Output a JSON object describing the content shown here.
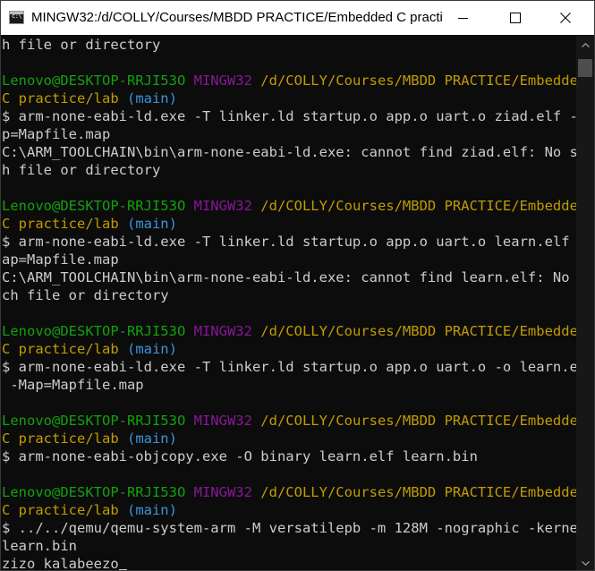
{
  "window": {
    "title": "MINGW32:/d/COLLY/Courses/MBDD PRACTICE/Embedded C practi…",
    "icon": "terminal-icon"
  },
  "colors": {
    "background": "#0c0c0c",
    "text": "#cccccc",
    "user_host": "#13a10e",
    "mingw": "#881798",
    "path": "#c19c00",
    "branch": "#3a96dd"
  },
  "terminal": {
    "lines": [
      {
        "parts": [
          {
            "text": "h file or directory",
            "color": "default"
          }
        ]
      },
      {
        "parts": []
      },
      {
        "parts": [
          {
            "text": "Lenovo@DESKTOP-RRJI53O ",
            "color": "green"
          },
          {
            "text": "MINGW32 ",
            "color": "purple"
          },
          {
            "text": "/d/COLLY/Courses/MBDD PRACTICE/Embedded",
            "color": "yellow"
          }
        ]
      },
      {
        "parts": [
          {
            "text": "C practice/lab ",
            "color": "yellow"
          },
          {
            "text": "(main)",
            "color": "cyan"
          }
        ]
      },
      {
        "parts": [
          {
            "text": "$ arm-none-eabi-ld.exe -T linker.ld startup.o app.o uart.o ziad.elf -Ma",
            "color": "default"
          }
        ]
      },
      {
        "parts": [
          {
            "text": "p=Mapfile.map",
            "color": "default"
          }
        ]
      },
      {
        "parts": [
          {
            "text": "C:\\ARM_TOOLCHAIN\\bin\\arm-none-eabi-ld.exe: cannot find ziad.elf: No suc",
            "color": "default"
          }
        ]
      },
      {
        "parts": [
          {
            "text": "h file or directory",
            "color": "default"
          }
        ]
      },
      {
        "parts": []
      },
      {
        "parts": [
          {
            "text": "Lenovo@DESKTOP-RRJI53O ",
            "color": "green"
          },
          {
            "text": "MINGW32 ",
            "color": "purple"
          },
          {
            "text": "/d/COLLY/Courses/MBDD PRACTICE/Embedded",
            "color": "yellow"
          }
        ]
      },
      {
        "parts": [
          {
            "text": "C practice/lab ",
            "color": "yellow"
          },
          {
            "text": "(main)",
            "color": "cyan"
          }
        ]
      },
      {
        "parts": [
          {
            "text": "$ arm-none-eabi-ld.exe -T linker.ld startup.o app.o uart.o learn.elf -M",
            "color": "default"
          }
        ]
      },
      {
        "parts": [
          {
            "text": "ap=Mapfile.map",
            "color": "default"
          }
        ]
      },
      {
        "parts": [
          {
            "text": "C:\\ARM_TOOLCHAIN\\bin\\arm-none-eabi-ld.exe: cannot find learn.elf: No su",
            "color": "default"
          }
        ]
      },
      {
        "parts": [
          {
            "text": "ch file or directory",
            "color": "default"
          }
        ]
      },
      {
        "parts": []
      },
      {
        "parts": [
          {
            "text": "Lenovo@DESKTOP-RRJI53O ",
            "color": "green"
          },
          {
            "text": "MINGW32 ",
            "color": "purple"
          },
          {
            "text": "/d/COLLY/Courses/MBDD PRACTICE/Embedded",
            "color": "yellow"
          }
        ]
      },
      {
        "parts": [
          {
            "text": "C practice/lab ",
            "color": "yellow"
          },
          {
            "text": "(main)",
            "color": "cyan"
          }
        ]
      },
      {
        "parts": [
          {
            "text": "$ arm-none-eabi-ld.exe -T linker.ld startup.o app.o uart.o -o learn.elf",
            "color": "default"
          }
        ]
      },
      {
        "parts": [
          {
            "text": " -Map=Mapfile.map",
            "color": "default"
          }
        ]
      },
      {
        "parts": []
      },
      {
        "parts": [
          {
            "text": "Lenovo@DESKTOP-RRJI53O ",
            "color": "green"
          },
          {
            "text": "MINGW32 ",
            "color": "purple"
          },
          {
            "text": "/d/COLLY/Courses/MBDD PRACTICE/Embedded",
            "color": "yellow"
          }
        ]
      },
      {
        "parts": [
          {
            "text": "C practice/lab ",
            "color": "yellow"
          },
          {
            "text": "(main)",
            "color": "cyan"
          }
        ]
      },
      {
        "parts": [
          {
            "text": "$ arm-none-eabi-objcopy.exe -O binary learn.elf learn.bin",
            "color": "default"
          }
        ]
      },
      {
        "parts": []
      },
      {
        "parts": [
          {
            "text": "Lenovo@DESKTOP-RRJI53O ",
            "color": "green"
          },
          {
            "text": "MINGW32 ",
            "color": "purple"
          },
          {
            "text": "/d/COLLY/Courses/MBDD PRACTICE/Embedded",
            "color": "yellow"
          }
        ]
      },
      {
        "parts": [
          {
            "text": "C practice/lab ",
            "color": "yellow"
          },
          {
            "text": "(main)",
            "color": "cyan"
          }
        ]
      },
      {
        "parts": [
          {
            "text": "$ ../../qemu/qemu-system-arm -M versatilepb -m 128M -nographic -kernel",
            "color": "default"
          }
        ]
      },
      {
        "parts": [
          {
            "text": "learn.bin",
            "color": "default"
          }
        ]
      },
      {
        "parts": [
          {
            "text": "zizo kalabeezo",
            "color": "default"
          }
        ],
        "cursor": true
      }
    ]
  }
}
